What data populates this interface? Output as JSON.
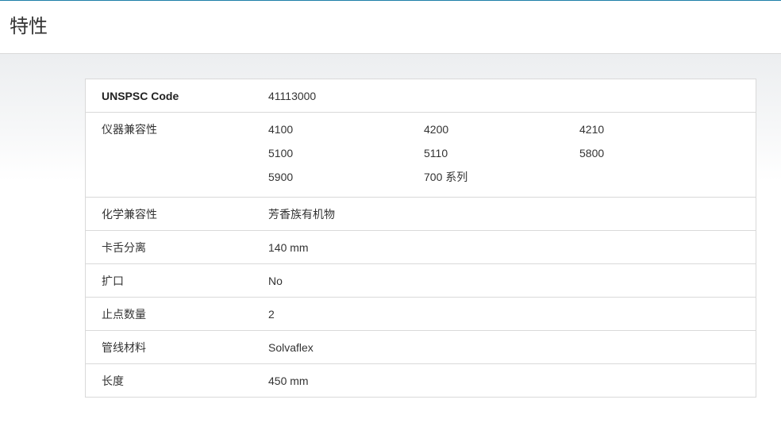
{
  "header": {
    "title": "特性",
    "accent_color": "#1e7fa8"
  },
  "specs": {
    "rows": [
      {
        "label": "UNSPSC Code",
        "value": "41113000"
      },
      {
        "label": "仪器兼容性",
        "values": [
          "4100",
          "4200",
          "4210",
          "5100",
          "5110",
          "5800",
          "5900",
          "700 系列"
        ]
      },
      {
        "label": "化学兼容性",
        "value": "芳香族有机物"
      },
      {
        "label": "卡舌分离",
        "value": "140 mm"
      },
      {
        "label": "扩口",
        "value": "No"
      },
      {
        "label": "止点数量",
        "value": "2"
      },
      {
        "label": "管线材料",
        "value": "Solvaflex"
      },
      {
        "label": "长度",
        "value": "450 mm"
      }
    ]
  }
}
